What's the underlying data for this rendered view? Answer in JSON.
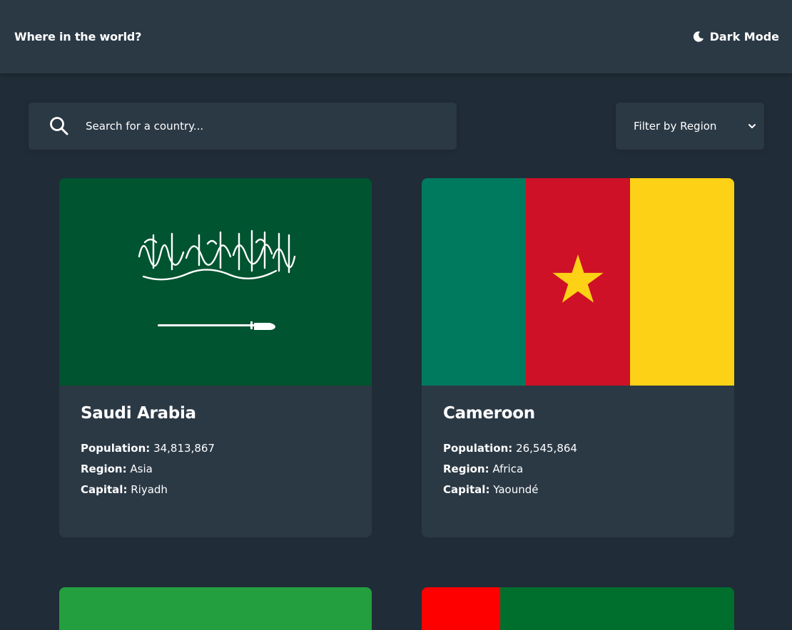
{
  "header": {
    "title": "Where in the world?",
    "theme_toggle_label": "Dark Mode",
    "theme_icon": "moon-icon"
  },
  "search": {
    "placeholder": "Search for a country...",
    "value": "",
    "icon": "search-icon"
  },
  "filter": {
    "label": "Filter by Region",
    "icon": "chevron-down-icon"
  },
  "labels": {
    "population": "Population:",
    "region": "Region:",
    "capital": "Capital:"
  },
  "countries": [
    {
      "name": "Saudi Arabia",
      "population": "34,813,867",
      "region": "Asia",
      "capital": "Riyadh",
      "flag_colors": [
        "#005430",
        "#ffffff"
      ]
    },
    {
      "name": "Cameroon",
      "population": "26,545,864",
      "region": "Africa",
      "capital": "Yaoundé",
      "flag_colors": [
        "#007a5e",
        "#ce1126",
        "#fcd116"
      ]
    },
    {
      "flag_colors": [
        "#239f40"
      ]
    },
    {
      "flag_colors": [
        "#ff0000",
        "#006f2d"
      ]
    }
  ],
  "colors": {
    "background": "#202c37",
    "surface": "#2b3945",
    "text": "#ffffff"
  }
}
